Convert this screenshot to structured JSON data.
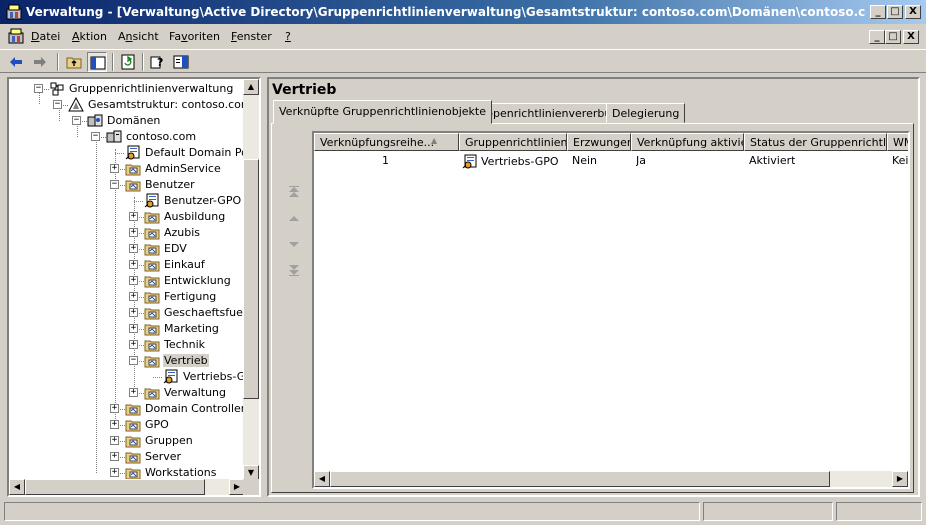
{
  "window": {
    "title": "Verwaltung - [Verwaltung\\Active Directory\\Gruppenrichtlinienverwaltung\\Gesamtstruktur: contoso.com\\Domänen\\contoso.com\\Benutzer\\Vertrie..."
  },
  "caption_buttons": {
    "minimize": "_",
    "restore": "□",
    "close": "X"
  },
  "menu": {
    "items": [
      {
        "label": "Datei",
        "accel": "D"
      },
      {
        "label": "Aktion",
        "accel": "A"
      },
      {
        "label": "Ansicht",
        "accel": "n"
      },
      {
        "label": "Favoriten",
        "accel": "v"
      },
      {
        "label": "Fenster",
        "accel": "F"
      },
      {
        "label": "?",
        "accel": "?"
      }
    ]
  },
  "tree": {
    "nodes": [
      {
        "label": "Gruppenrichtlinienverwaltung",
        "icon": "gpmc-icon"
      },
      {
        "label": "Gesamtstruktur: contoso.com",
        "icon": "forest-icon"
      },
      {
        "label": "Domänen",
        "icon": "domains-icon"
      },
      {
        "label": "contoso.com",
        "icon": "domain-icon"
      },
      {
        "label": "Default Domain Policy",
        "icon": "gpo-link-icon"
      },
      {
        "label": "AdminService",
        "icon": "ou-icon"
      },
      {
        "label": "Benutzer",
        "icon": "ou-icon"
      },
      {
        "label": "Benutzer-GPO",
        "icon": "gpo-link-icon"
      },
      {
        "label": "Ausbildung",
        "icon": "ou-icon"
      },
      {
        "label": "Azubis",
        "icon": "ou-icon"
      },
      {
        "label": "EDV",
        "icon": "ou-icon"
      },
      {
        "label": "Einkauf",
        "icon": "ou-icon"
      },
      {
        "label": "Entwicklung",
        "icon": "ou-icon"
      },
      {
        "label": "Fertigung",
        "icon": "ou-icon"
      },
      {
        "label": "Geschaeftsfuehrung",
        "icon": "ou-icon"
      },
      {
        "label": "Marketing",
        "icon": "ou-icon"
      },
      {
        "label": "Technik",
        "icon": "ou-icon"
      },
      {
        "label": "Vertrieb",
        "icon": "ou-icon"
      },
      {
        "label": "Vertriebs-GPO",
        "icon": "gpo-link-icon"
      },
      {
        "label": "Verwaltung",
        "icon": "ou-icon"
      },
      {
        "label": "Domain Controllers",
        "icon": "ou-icon"
      },
      {
        "label": "GPO",
        "icon": "ou-icon"
      },
      {
        "label": "Gruppen",
        "icon": "ou-icon"
      },
      {
        "label": "Server",
        "icon": "ou-icon"
      },
      {
        "label": "Workstations",
        "icon": "ou-icon"
      }
    ],
    "expander_plus": "+",
    "expander_minus": "−",
    "selected": "Vertrieb"
  },
  "details": {
    "title": "Vertrieb",
    "tabs": [
      {
        "label": "Verknüpfte Gruppenrichtlinienobjekte",
        "active": true
      },
      {
        "label": "Gruppenrichtlinienvererbung",
        "active": false
      },
      {
        "label": "Delegierung",
        "active": false
      }
    ],
    "columns": [
      "Verknüpfungsreihe...",
      "Gruppenrichtlinien...",
      "Erzwungen",
      "Verknüpfung aktiviert",
      "Status der Gruppenrichtlinie",
      "WMI-Filter"
    ],
    "sort_indicator": "▲",
    "rows": [
      {
        "order": "1",
        "gpo": "Vertriebs-GPO",
        "enforced": "Nein",
        "link_enabled": "Ja",
        "status": "Aktiviert",
        "wmi": "Keine"
      }
    ]
  },
  "colors": {
    "titlebar": "#0a246a",
    "face": "#d4d0c8",
    "ou_folder": "#e8d28a"
  }
}
